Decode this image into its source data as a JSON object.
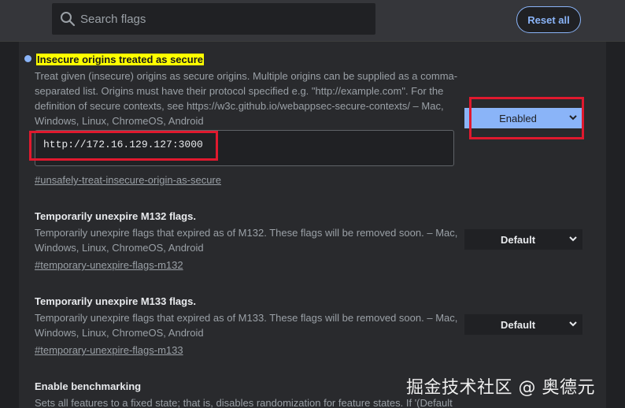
{
  "search": {
    "placeholder": "Search flags",
    "value": ""
  },
  "header": {
    "reset_label": "Reset all"
  },
  "flags": [
    {
      "title": "Insecure origins treated as secure",
      "description_lines": [
        "Treat given (insecure) origins as secure origins. Multiple origins can be supplied as a comma-",
        "separated list. Origins must have their protocol specified e.g. \"http://example.com\". For the",
        "definition of secure contexts, see https://w3c.github.io/webappsec-secure-contexts/ – Mac,",
        "Windows, Linux, ChromeOS, Android"
      ],
      "textarea_value": "http://172.16.129.127:3000",
      "link": "#unsafely-treat-insecure-origin-as-secure",
      "select_value": "Enabled",
      "modified": true
    },
    {
      "title": "Temporarily unexpire M132 flags.",
      "description_lines": [
        "Temporarily unexpire flags that expired as of M132. These flags will be removed soon. – Mac,",
        "Windows, Linux, ChromeOS, Android"
      ],
      "link": "#temporary-unexpire-flags-m132",
      "select_value": "Default"
    },
    {
      "title": "Temporarily unexpire M133 flags.",
      "description_lines": [
        "Temporarily unexpire flags that expired as of M133. These flags will be removed soon. – Mac,",
        "Windows, Linux, ChromeOS, Android"
      ],
      "link": "#temporary-unexpire-flags-m133",
      "select_value": "Default"
    },
    {
      "title": "Enable benchmarking",
      "description_lines": [
        "Sets all features to a fixed state; that is, disables randomization for feature states. If '(Default"
      ]
    }
  ],
  "watermark": "掘金技术社区 @ 奥德元",
  "colors": {
    "accent": "#8ab4f8",
    "highlight": "#ffff00",
    "annotation_red": "#e0192e"
  }
}
